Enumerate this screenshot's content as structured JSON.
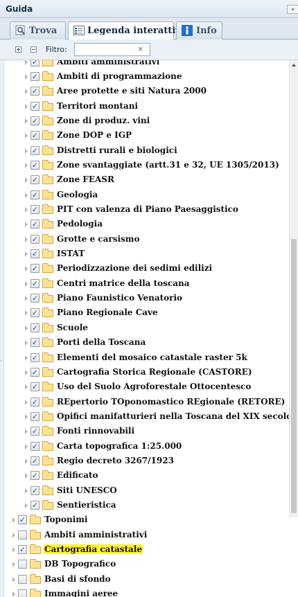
{
  "panel": {
    "title": "Guida",
    "collapse_glyph": "»"
  },
  "tabs": [
    {
      "label": "Trova",
      "icon": "search-icon",
      "active": false
    },
    {
      "label": "Legenda interattiva",
      "icon": "legend-icon",
      "active": true
    },
    {
      "label": "Info",
      "icon": "info-icon",
      "active": false
    }
  ],
  "toolbar": {
    "expand_all_icon": "expand-all-icon",
    "collapse_all_icon": "collapse-all-icon",
    "filter_label": "Filtro:",
    "filter_value": "",
    "filter_clear_glyph": "×"
  },
  "colors": {
    "highlight": "#fff232",
    "checkmark": "#2453a8",
    "folder": "#fde39a"
  },
  "tree": {
    "children": [
      {
        "label": "Ambiti amministrativi",
        "checked": true
      },
      {
        "label": "Ambiti di programmazione",
        "checked": true
      },
      {
        "label": "Aree protette e siti Natura 2000",
        "checked": true
      },
      {
        "label": "Territori montani",
        "checked": true
      },
      {
        "label": "Zone di produz. vini",
        "checked": true
      },
      {
        "label": "Zone DOP e IGP",
        "checked": true
      },
      {
        "label": "Distretti rurali e biologici",
        "checked": true
      },
      {
        "label": "Zone svantaggiate (artt.31 e 32, UE 1305/2013)",
        "checked": true
      },
      {
        "label": "Zone FEASR",
        "checked": true
      },
      {
        "label": "Geologia",
        "checked": true
      },
      {
        "label": "PIT con valenza di Piano Paesaggistico",
        "checked": true
      },
      {
        "label": "Pedologia",
        "checked": true
      },
      {
        "label": "Grotte e carsismo",
        "checked": true
      },
      {
        "label": "ISTAT",
        "checked": true
      },
      {
        "label": "Periodizzazione dei sedimi edilizi",
        "checked": true
      },
      {
        "label": "Centri matrice della toscana",
        "checked": true
      },
      {
        "label": "Piano Faunistico Venatorio",
        "checked": true
      },
      {
        "label": "Piano Regionale Cave",
        "checked": true
      },
      {
        "label": "Scuole",
        "checked": true
      },
      {
        "label": "Porti della Toscana",
        "checked": true
      },
      {
        "label": "Elementi del mosaico catastale raster 5k",
        "checked": true
      },
      {
        "label": "Cartografia Storica Regionale (CASTORE)",
        "checked": true
      },
      {
        "label": "Uso del Suolo Agroforestale Ottocentesco",
        "checked": true
      },
      {
        "label": "REpertorio TOponomastico REgionale (RETORE)",
        "checked": true
      },
      {
        "label": "Opifici manifatturieri nella Toscana del XIX secolo",
        "checked": true
      },
      {
        "label": "Fonti rinnovabili",
        "checked": true
      },
      {
        "label": "Carta topografica 1:25.000",
        "checked": true
      },
      {
        "label": "Regio decreto 3267/1923",
        "checked": true
      },
      {
        "label": "Edificato",
        "checked": true
      },
      {
        "label": "Siti UNESCO",
        "checked": true
      },
      {
        "label": "Sentieristica",
        "checked": true
      }
    ],
    "roots": [
      {
        "label": "Toponimi",
        "checked": true
      },
      {
        "label": "Ambiti amministrativi",
        "checked": false
      },
      {
        "label": "Cartografia catastale",
        "checked": true,
        "highlighted": true
      },
      {
        "label": "DB Topografico",
        "checked": false
      },
      {
        "label": "Basi di sfondo",
        "checked": false
      },
      {
        "label": "Immagini aeree",
        "checked": false
      }
    ]
  }
}
